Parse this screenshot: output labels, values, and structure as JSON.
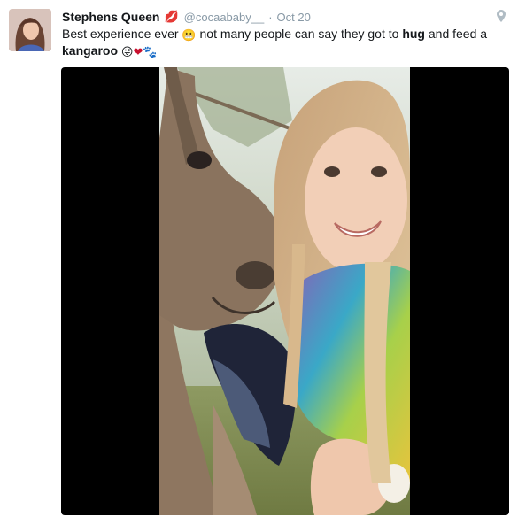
{
  "tweet": {
    "author": {
      "display_name": "Stephens Queen",
      "name_emoji": "💋",
      "handle": "@cocaababy__",
      "avatar_icon": "user-avatar"
    },
    "separator": "·",
    "date": "Oct 20",
    "geo_icon": "location-pin-icon",
    "text": {
      "part1": "Best experience ever",
      "emoji1": "😬",
      "part2": "not many people can say they got to",
      "bold1": "hug",
      "part3": "and feed a",
      "bold2": "kangaroo",
      "emoji2": "😜",
      "emoji3": "❤",
      "emoji4": "🐾"
    },
    "media": {
      "type": "video",
      "subject": "kangaroo-selfie"
    }
  },
  "colors": {
    "name": "#14171a",
    "meta": "#8899a6",
    "media_bg": "#000000",
    "lips": "#d3304a",
    "heart": "#c8102e"
  }
}
